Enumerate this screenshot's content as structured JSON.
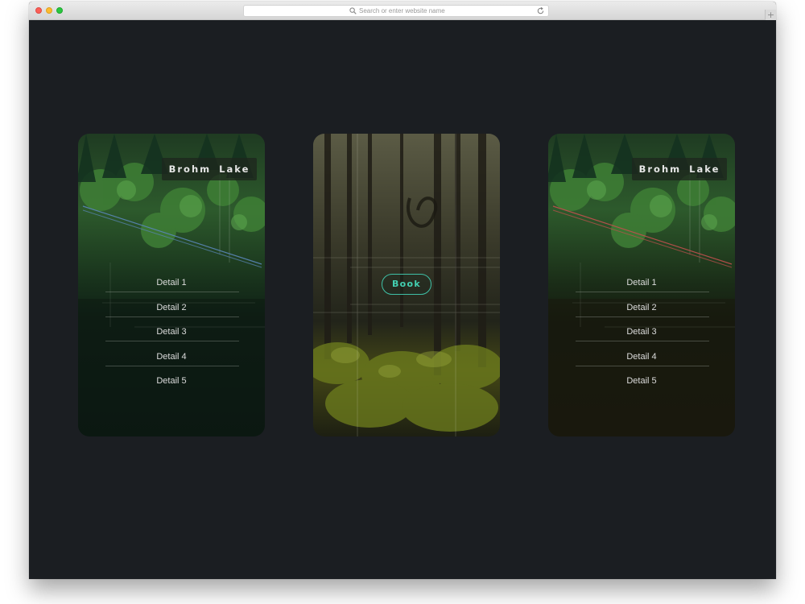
{
  "browser": {
    "url_placeholder": "Search or enter website name",
    "new_tab_label": "+"
  },
  "cards": {
    "left": {
      "title": "Brohm Lake",
      "accent": "#5a86b8",
      "details": [
        "Detail 1",
        "Detail 2",
        "Detail 3",
        "Detail 4",
        "Detail 5"
      ]
    },
    "middle": {
      "button_label": "Book",
      "accent": "#3fc0a6"
    },
    "right": {
      "title": "Brohm Lake",
      "accent": "#c0504e",
      "details": [
        "Detail 1",
        "Detail 2",
        "Detail 3",
        "Detail 4",
        "Detail 5"
      ]
    }
  },
  "colors": {
    "page_background": "#1b1e22"
  }
}
